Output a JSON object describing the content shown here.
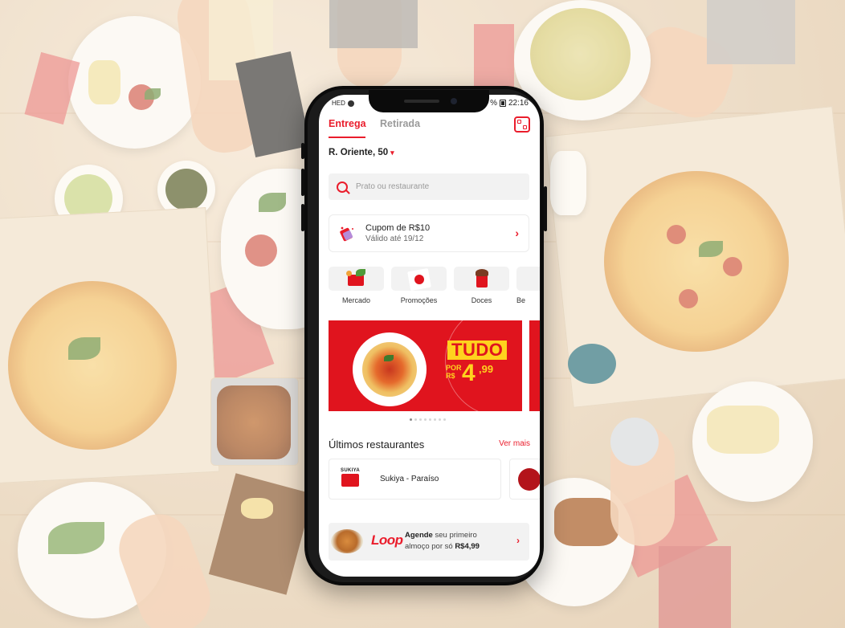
{
  "status_bar": {
    "left_text": "HED",
    "time": "22:16",
    "battery_percent": "%"
  },
  "tabs": [
    {
      "label": "Entrega",
      "active": true
    },
    {
      "label": "Retirada",
      "active": false
    }
  ],
  "address": {
    "text": "R. Oriente, 50"
  },
  "search": {
    "placeholder": "Prato ou restaurante"
  },
  "coupon": {
    "title": "Cupom de R$10",
    "subtitle": "Válido até 19/12"
  },
  "categories": [
    {
      "label": "Mercado",
      "icon": "grocery-basket-icon"
    },
    {
      "label": "Promoções",
      "icon": "promo-box-icon"
    },
    {
      "label": "Doces",
      "icon": "ice-cream-icon"
    },
    {
      "label": "Be",
      "icon": "drink-icon"
    }
  ],
  "banner": {
    "headline": "TUDO",
    "por_label": "POR",
    "currency": "R$",
    "price_main": "4",
    "price_cents": ",99",
    "dots_total": 8,
    "dots_active": 1
  },
  "recent": {
    "title": "Últimos restaurantes",
    "more_label": "Ver mais",
    "restaurants": [
      {
        "name": "Sukiya - Paraíso",
        "logo_text": "SUKIYA"
      }
    ]
  },
  "loop_promo": {
    "logo": "Loop",
    "text_bold": "Agende",
    "text_rest": " seu primeiro",
    "text_line2": "almoço por só ",
    "price": "R$4,99"
  },
  "colors": {
    "accent": "#ea1d2c",
    "banner_bg": "#e0141e",
    "banner_yellow": "#ffd21e"
  }
}
